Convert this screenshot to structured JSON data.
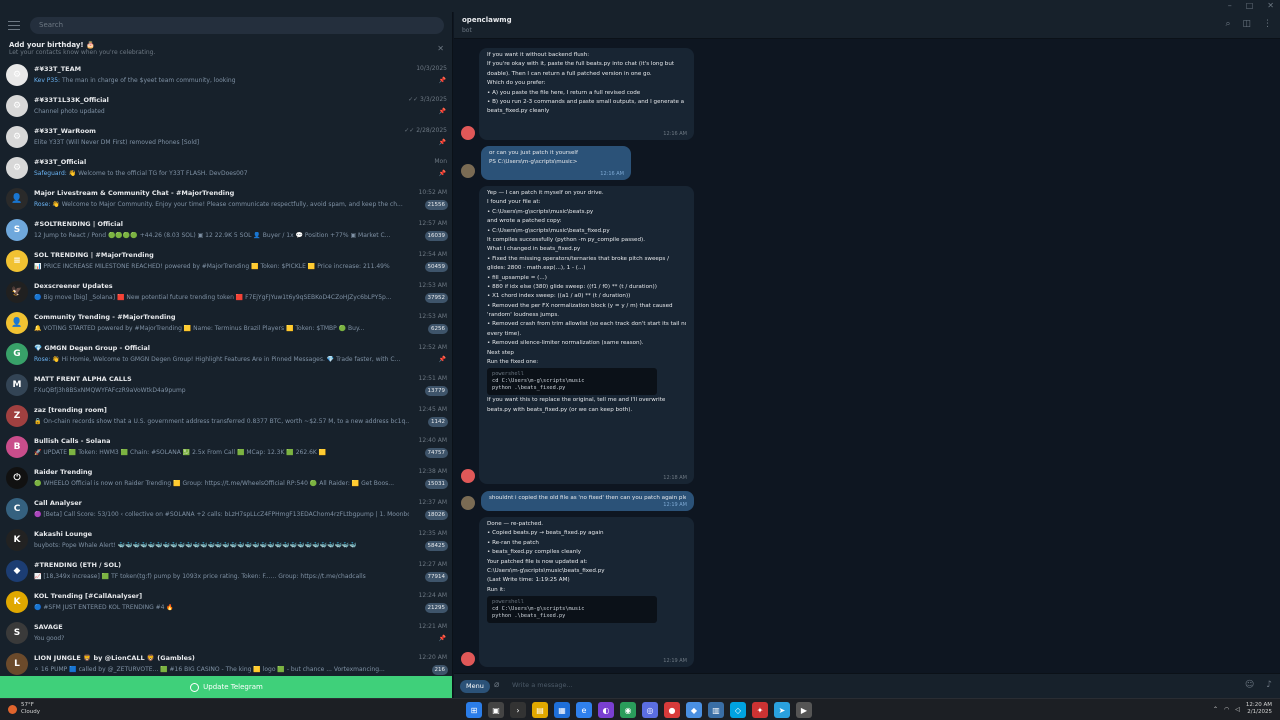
{
  "search": {
    "placeholder": "Search"
  },
  "birthday_banner": {
    "title": "Add your birthday! 🎂",
    "subtitle": "Let your contacts know when you're celebrating."
  },
  "chats": [
    {
      "name": "#¥33T_TEAM",
      "time": "10/3/2025",
      "msg_hl": "Kev P35:",
      "msg": " The man in charge of the $yeet team community, looking",
      "badge": "",
      "color": "#e8e8e8",
      "letter": "⚙"
    },
    {
      "name": "#¥33T1L33K_Official",
      "time": "✓✓ 3/3/2025",
      "msg_hl": "",
      "msg": "Channel photo updated",
      "badge": "",
      "color": "#d8d8d8",
      "letter": "⚙"
    },
    {
      "name": "#¥33T_WarRoom",
      "time": "✓✓ 2/28/2025",
      "msg_hl": "",
      "msg": "Elite Y33T (Will Never DM First) removed Phones [Sold]",
      "badge": "",
      "color": "#d8d8d8",
      "letter": "⚙"
    },
    {
      "name": "#¥33T_Official",
      "time": "Mon",
      "msg_hl": "Safeguard:",
      "msg": " 👋 Welcome to the official TG for Y33T FLASH. DevDoes007",
      "badge": "",
      "color": "#d8d8d8",
      "letter": "⚙"
    },
    {
      "name": "Major Livestream & Community Chat - #MajorTrending",
      "time": "10:52 AM",
      "msg_hl": "Rose:",
      "msg": " 👋 Welcome to Major Community. Enjoy your time! Please communicate respectfully, avoid spam, and keep the ch...",
      "badge": "21556",
      "color": "#2a2a2a",
      "letter": "👤"
    },
    {
      "name": "#SOLTRENDING | Official",
      "time": "12:57 AM",
      "msg_hl": "",
      "msg": "12 Jump to React / Pond 🟢🟢🟢🟢 +44.26 (8.03 SOL) ▣ 12 22.9K 5 SOL 👤 Buyer / 1x 💬 Position +77% ▣ Market C...",
      "badge": "16039",
      "color": "#6fa8dc",
      "letter": "S"
    },
    {
      "name": "SOL TRENDING | #MajorTrending",
      "time": "12:54 AM",
      "msg_hl": "",
      "msg": "📊 PRICE INCREASE MILESTONE REACHED! powered by #MajorTrending 🟨 Token: $PICKLE 🟨 Price increase: 211.49%",
      "badge": "50459",
      "color": "#f1c232",
      "letter": "≡"
    },
    {
      "name": "Dexscreener Updates",
      "time": "12:53 AM",
      "msg_hl": "",
      "msg": "🔵 Big move [big] _Solana] 🟥 New potential future trending token 🟥 F7EjYgFJYuw1t6y9qSEBKoD4CZoHJZyc6bLPY5p...",
      "badge": "37952",
      "color": "#202020",
      "letter": "🦅"
    },
    {
      "name": "Community Trending - #MajorTrending",
      "time": "12:53 AM",
      "msg_hl": "",
      "msg": "🔔 VOTING STARTED powered by #MajorTrending 🟨 Name: Terminus Brazil Players 🟨 Token: $TMBP 🟢 Buy...",
      "badge": "6256",
      "color": "#f1c232",
      "letter": "👤"
    },
    {
      "name": "💎 GMGN Degen Group - Official",
      "time": "12:52 AM",
      "msg_hl": "Rose:",
      "msg": " 👋 Hi Homie, Welcome to GMGN Degen Group! Highlight Features Are in Pinned Messages. 💎 Trade faster, with C...",
      "badge": "",
      "color": "#38a169",
      "letter": "G"
    },
    {
      "name": "MATT FRENT ALPHA CALLS",
      "time": "12:51 AM",
      "msg_hl": "",
      "msg": "FXuQBfj3h8BSxNMQWYFAFczR9aVoWtkD4a9pump",
      "badge": "13779",
      "color": "#334455",
      "letter": "M"
    },
    {
      "name": "zaz [trending room]",
      "time": "12:45 AM",
      "msg_hl": "",
      "msg": "🔒 On-chain records show that a U.S. government address transferred 0.8377 BTC, worth ~$2.57 M, to a new address bc1q...",
      "badge": "1142",
      "color": "#a04040",
      "letter": "Z"
    },
    {
      "name": "Bullish Calls - Solana",
      "time": "12:40 AM",
      "msg_hl": "",
      "msg": "🚀 UPDATE 🟩 Token: HWM3 🟩 Chain: #SOLANA 💹 2.5x From Call 🟩 MCap: 12.3K 🟩 262.6K 🟨",
      "badge": "74757",
      "color": "#c94d8b",
      "letter": "B"
    },
    {
      "name": "Raider Trending",
      "time": "12:38 AM",
      "msg_hl": "",
      "msg": "🟢 WHEELO Official is now on Raider Trending 🟨 Group: https://t.me/WheelsOfficial RP:540 🟢 All Raider: 🟨 Get Boos...",
      "badge": "15031",
      "color": "#111111",
      "letter": "⏻"
    },
    {
      "name": "Call Analyser",
      "time": "12:37 AM",
      "msg_hl": "",
      "msg": "🟣 [Beta] Call Score: 53/100 ‹ collective on #SOLANA +2 calls: bLzH7spLLcZ4FPHmgF13EDAChom4rzFLtbgpump | 1. Moonbot Cal...",
      "badge": "18026",
      "color": "#35617f",
      "letter": "C"
    },
    {
      "name": "Kakashi Lounge",
      "time": "12:35 AM",
      "msg_hl": "",
      "msg": "buybots: Pope Whale Alert! 🐳🐳🐳🐳🐳🐳🐳🐳🐳🐳🐳🐳🐳🐳🐳🐳🐳🐳🐳🐳🐳🐳🐳🐳🐳🐳🐳🐳🐳🐳🐳🐳",
      "badge": "58425",
      "color": "#222222",
      "letter": "K"
    },
    {
      "name": "#TRENDING (ETH / SOL)",
      "time": "12:27 AM",
      "msg_hl": "",
      "msg": "📈 [18,349x increase] 🟩 TF token(tg:f) pump by 1093x price rating. Token: F...... Group: https://t.me/chadcalls",
      "badge": "77914",
      "color": "#1c3d73",
      "letter": "◆"
    },
    {
      "name": "KOL Trending [#CallAnalyser]",
      "time": "12:24 AM",
      "msg_hl": "",
      "msg": "🔵 #SFM JUST ENTERED KOL TRENDING #4 🔥",
      "badge": "21295",
      "color": "#e0a800",
      "letter": "K"
    },
    {
      "name": "SAVAGE",
      "time": "12:21 AM",
      "msg_hl": "",
      "msg": "You good?",
      "badge": "",
      "color": "#3a3a3a",
      "letter": "S"
    },
    {
      "name": "LION JUNGLE 🦁 by @LionCALL 🦁 (Gambles)",
      "time": "12:20 AM",
      "msg_hl": "",
      "msg": "⚪ 16 PUMP 🟦 called by @_ZETURVOTE... 🟩 #16 BIG CASINO - The king 🟨 logo 🟩 - but chance ... Vortexmancing...",
      "badge": "216",
      "color": "#6b4a2b",
      "letter": "L"
    }
  ],
  "update_bar": {
    "label": "Update Telegram"
  },
  "conversation": {
    "title": "openclawmg",
    "subtitle": "bot"
  },
  "messages": {
    "m1": [
      "If you want it without backend flush:",
      "If you're okay with it, paste the full beats.py into chat (it's long but",
      "doable). Then I can return a full patched version in one go.",
      "Which do you prefer:",
      "• A) you paste the file here, I return a full revised code",
      "• B) you run 2-3 commands and paste small outputs, and I generate a",
      "beats_fixed.py cleanly"
    ],
    "m1_ts": "12:16 AM",
    "m2": [
      "or can you just patch it yourself",
      "PS C:\\Users\\m-g\\scripts\\music>"
    ],
    "m2_ts": "12:16 AM",
    "m3_intro": [
      "Yep — I can patch it myself on your drive.",
      "I found your file at:",
      "• C:\\Users\\m-g\\scripts\\music\\beats.py",
      "and wrote a patched copy:",
      "• C:\\Users\\m-g\\scripts\\music\\beats_fixed.py",
      "It compiles successfully (python -m py_compile passed).",
      "What I changed in beats_fixed.py",
      "• Fixed the missing operators/ternaries that broke pitch sweeps /",
      "glides: 2800 · math.exp(...), 1 - (...)",
      "  • fill_upsample = (...)",
      "  • 880 if idx else (380) glide sweep: ((f1 / f0) ** (t / duration))",
      "  • X1 chord index sweep: ((a1 / a0) ** (t / duration))",
      "• Removed the per FX normalization block (y = y / m) that caused",
      "'random' loudness jumps.",
      "• Removed crash from trim allowlist (so each track don't start its tail note",
      "every time).",
      "• Removed silence-limiter normalization (same reason).",
      "Next step",
      "Run the fixed one:"
    ],
    "code1": [
      "powershell",
      "cd C:\\Users\\m-g\\scripts\\music",
      "python .\\beats_fixed.py"
    ],
    "m3_outro": [
      "If you want this to replace the original, tell me and I'll overwrite",
      "beats.py with beats_fixed.py (or we can keep both)."
    ],
    "m3_ts": "12:18 AM",
    "m4": "shouldnt i copied the old file as 'no fixed' then can you patch again please",
    "m4_ts": "12:19 AM",
    "m5_intro": [
      "Done — re-patched.",
      "• Copied beats.py → beats_fixed.py again",
      "• Re-ran the patch",
      "• beats_fixed.py compiles cleanly",
      "Your patched file is now updated at:",
      "C:\\Users\\m-g\\scripts\\music\\beats_fixed.py",
      "(Last Write time: 1:19:25 AM)",
      "Run it:"
    ],
    "code2": [
      "powershell",
      "cd C:\\Users\\m-g\\scripts\\music",
      "python .\\beats_fixed.py"
    ],
    "m5_ts": "12:19 AM"
  },
  "composer": {
    "menu_label": "Menu",
    "placeholder": "Write a message..."
  },
  "taskbar": {
    "weather_temp": "57°F",
    "weather_desc": "Cloudy",
    "time": "12:20 AM",
    "date": "2/1/2025"
  }
}
